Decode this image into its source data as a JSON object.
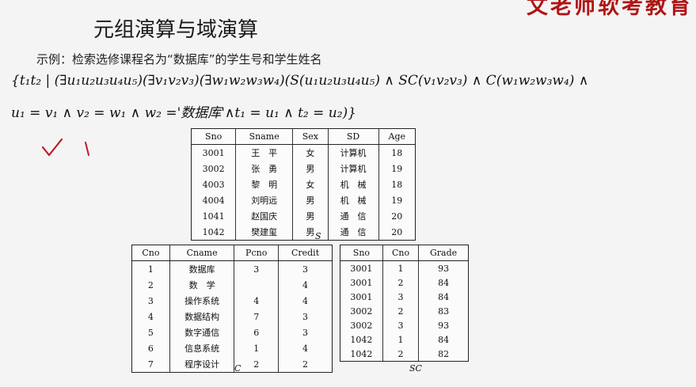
{
  "brand": "文老师软考教育",
  "title": "元组演算与域演算",
  "subtitle": "示例：检索选修课程名为“数据库”的学生号和学生姓名",
  "formula_line1": "{t₁t₂ | (∃u₁u₂u₃u₄u₅)(∃v₁v₂v₃)(∃w₁w₂w₃w₄)(S(u₁u₂u₃u₄u₅) ∧ SC(v₁v₂v₃) ∧ C(w₁w₂w₃w₄) ∧",
  "formula_line2": "u₁ = v₁ ∧ v₂ = w₁ ∧ w₂ ='数据库'∧t₁ = u₁ ∧ t₂ = u₂)}",
  "tables": {
    "S": {
      "caption": "S",
      "headers": [
        "Sno",
        "Sname",
        "Sex",
        "SD",
        "Age"
      ],
      "rows": [
        [
          "3001",
          "王　平",
          "女",
          "计算机",
          "18"
        ],
        [
          "3002",
          "张　勇",
          "男",
          "计算机",
          "19"
        ],
        [
          "4003",
          "黎　明",
          "女",
          "机　械",
          "18"
        ],
        [
          "4004",
          "刘明远",
          "男",
          "机　械",
          "19"
        ],
        [
          "1041",
          "赵国庆",
          "男",
          "通　信",
          "20"
        ],
        [
          "1042",
          "樊建玺",
          "男",
          "通　信",
          "20"
        ]
      ]
    },
    "C": {
      "caption": "C",
      "headers": [
        "Cno",
        "Cname",
        "Pcno",
        "Credit"
      ],
      "rows": [
        [
          "1",
          "数据库",
          "3",
          "3"
        ],
        [
          "2",
          "数　学",
          "",
          "4"
        ],
        [
          "3",
          "操作系统",
          "4",
          "4"
        ],
        [
          "4",
          "数据结构",
          "7",
          "3"
        ],
        [
          "5",
          "数字通信",
          "6",
          "3"
        ],
        [
          "6",
          "信息系统",
          "1",
          "4"
        ],
        [
          "7",
          "程序设计",
          "2",
          "2"
        ]
      ]
    },
    "SC": {
      "caption": "SC",
      "headers": [
        "Sno",
        "Cno",
        "Grade"
      ],
      "rows": [
        [
          "3001",
          "1",
          "93"
        ],
        [
          "3001",
          "2",
          "84"
        ],
        [
          "3001",
          "3",
          "84"
        ],
        [
          "3002",
          "2",
          "83"
        ],
        [
          "3002",
          "3",
          "93"
        ],
        [
          "1042",
          "1",
          "84"
        ],
        [
          "1042",
          "2",
          "82"
        ]
      ]
    }
  }
}
